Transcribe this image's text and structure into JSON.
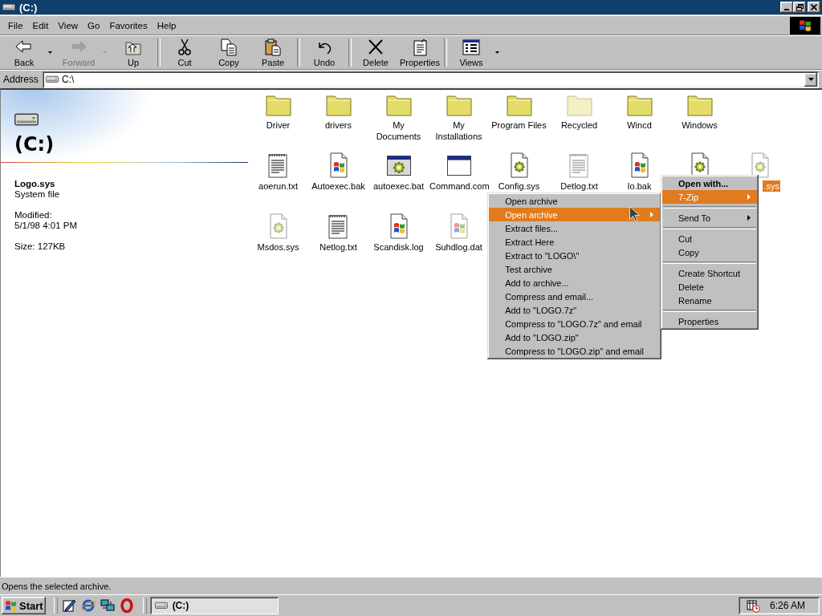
{
  "window": {
    "title": "(C:)"
  },
  "menu_bar": [
    "File",
    "Edit",
    "View",
    "Go",
    "Favorites",
    "Help"
  ],
  "toolbar": [
    {
      "kind": "back",
      "label": "Back",
      "dropdown": true,
      "disabled": false
    },
    {
      "kind": "forward",
      "label": "Forward",
      "dropdown": true,
      "disabled": true
    },
    {
      "kind": "up",
      "label": "Up",
      "dropdown": false,
      "disabled": false
    },
    {
      "kind": "separator"
    },
    {
      "kind": "cut",
      "label": "Cut",
      "dropdown": false,
      "disabled": false
    },
    {
      "kind": "copy",
      "label": "Copy",
      "dropdown": false,
      "disabled": false
    },
    {
      "kind": "paste",
      "label": "Paste",
      "dropdown": false,
      "disabled": false
    },
    {
      "kind": "separator"
    },
    {
      "kind": "undo",
      "label": "Undo",
      "dropdown": false,
      "disabled": false
    },
    {
      "kind": "separator"
    },
    {
      "kind": "delete",
      "label": "Delete",
      "dropdown": false,
      "disabled": false
    },
    {
      "kind": "properties",
      "label": "Properties",
      "dropdown": false,
      "disabled": false
    },
    {
      "kind": "separator"
    },
    {
      "kind": "views",
      "label": "Views",
      "dropdown": true,
      "disabled": false
    }
  ],
  "address": {
    "label": "Address",
    "value": "C:\\"
  },
  "info_panel": {
    "title": "(C:)",
    "file_name": "Logo.sys",
    "file_type": "System file",
    "modified_label": "Modified:",
    "modified": "5/1/98 4:01 PM",
    "size": "Size: 127KB"
  },
  "files": {
    "rows": [
      [
        {
          "kind": "folder",
          "label": "Driver",
          "hidden": false,
          "selected": false
        },
        {
          "kind": "folder",
          "label": "drivers",
          "hidden": false,
          "selected": false
        },
        {
          "kind": "folder",
          "label": "My Documents",
          "hidden": false,
          "selected": false
        },
        {
          "kind": "folder",
          "label": "My Installations",
          "hidden": false,
          "selected": false
        },
        {
          "kind": "folder",
          "label": "Program Files",
          "hidden": false,
          "selected": false
        },
        {
          "kind": "folder",
          "label": "Recycled",
          "hidden": true,
          "selected": false
        },
        {
          "kind": "folder",
          "label": "Wincd",
          "hidden": false,
          "selected": false
        },
        {
          "kind": "folder",
          "label": "Windows",
          "hidden": false,
          "selected": false
        }
      ],
      [
        {
          "kind": "text",
          "label": "aoerun.txt",
          "hidden": false,
          "selected": false
        },
        {
          "kind": "flag",
          "label": "Autoexec.bak",
          "hidden": false,
          "selected": false
        },
        {
          "kind": "batch",
          "label": "autoexec.bat",
          "hidden": false,
          "selected": false
        },
        {
          "kind": "app",
          "label": "Command.com",
          "hidden": false,
          "selected": false
        },
        {
          "kind": "gear",
          "label": "Config.sys",
          "hidden": false,
          "selected": false
        },
        {
          "kind": "text",
          "label": "Detlog.txt",
          "hidden": true,
          "selected": false
        },
        {
          "kind": "flag",
          "label": "Io.bak",
          "hidden": false,
          "selected": false
        },
        {
          "kind": "gear",
          "hidden": false,
          "selected": false
        },
        {
          "kind": "gear",
          "label": ".sys",
          "hidden": true,
          "selected": true
        }
      ],
      [
        {
          "kind": "gear",
          "label": "Msdos.sys",
          "hidden": true,
          "selected": false
        },
        {
          "kind": "text",
          "label": "Netlog.txt",
          "hidden": false,
          "selected": false
        },
        {
          "kind": "flag",
          "label": "Scandisk.log",
          "hidden": false,
          "selected": false
        },
        {
          "kind": "flag",
          "label": "Suhdlog.dat",
          "hidden": true,
          "selected": false
        }
      ]
    ]
  },
  "context_menu": {
    "items": [
      {
        "kind": "item",
        "label": "Open with...",
        "default": true,
        "submenu": false,
        "selected": false
      },
      {
        "kind": "item",
        "label": "7-Zip",
        "default": false,
        "submenu": true,
        "selected": true
      },
      {
        "kind": "separator"
      },
      {
        "kind": "item",
        "label": "Send To",
        "default": false,
        "submenu": true,
        "selected": false
      },
      {
        "kind": "separator"
      },
      {
        "kind": "item",
        "label": "Cut",
        "default": false,
        "submenu": false,
        "selected": false
      },
      {
        "kind": "item",
        "label": "Copy",
        "default": false,
        "submenu": false,
        "selected": false
      },
      {
        "kind": "separator"
      },
      {
        "kind": "item",
        "label": "Create Shortcut",
        "default": false,
        "submenu": false,
        "selected": false
      },
      {
        "kind": "item",
        "label": "Delete",
        "default": false,
        "submenu": false,
        "selected": false
      },
      {
        "kind": "item",
        "label": "Rename",
        "default": false,
        "submenu": false,
        "selected": false
      },
      {
        "kind": "separator"
      },
      {
        "kind": "item",
        "label": "Properties",
        "default": false,
        "submenu": false,
        "selected": false
      }
    ]
  },
  "submenu": {
    "items": [
      {
        "kind": "item",
        "label": "Open archive",
        "default": false,
        "submenu": false,
        "selected": false
      },
      {
        "kind": "item",
        "label": "Open archive",
        "default": false,
        "submenu": true,
        "selected": true
      },
      {
        "kind": "item",
        "label": "Extract files...",
        "default": false,
        "submenu": false,
        "selected": false
      },
      {
        "kind": "item",
        "label": "Extract Here",
        "default": false,
        "submenu": false,
        "selected": false
      },
      {
        "kind": "item",
        "label": "Extract to \"LOGO\\\"",
        "default": false,
        "submenu": false,
        "selected": false
      },
      {
        "kind": "item",
        "label": "Test archive",
        "default": false,
        "submenu": false,
        "selected": false
      },
      {
        "kind": "item",
        "label": "Add to archive...",
        "default": false,
        "submenu": false,
        "selected": false
      },
      {
        "kind": "item",
        "label": "Compress and email...",
        "default": false,
        "submenu": false,
        "selected": false
      },
      {
        "kind": "item",
        "label": "Add to \"LOGO.7z\"",
        "default": false,
        "submenu": false,
        "selected": false
      },
      {
        "kind": "item",
        "label": "Compress to \"LOGO.7z\" and email",
        "default": false,
        "submenu": false,
        "selected": false
      },
      {
        "kind": "item",
        "label": "Add to \"LOGO.zip\"",
        "default": false,
        "submenu": false,
        "selected": false
      },
      {
        "kind": "item",
        "label": "Compress to \"LOGO.zip\" and email",
        "default": false,
        "submenu": false,
        "selected": false
      }
    ]
  },
  "status_bar": "Opens the selected archive.",
  "taskbar": {
    "start": "Start",
    "tasks": [
      {
        "label": "(C:)",
        "selected": true
      }
    ],
    "clock": "6:26 AM"
  }
}
